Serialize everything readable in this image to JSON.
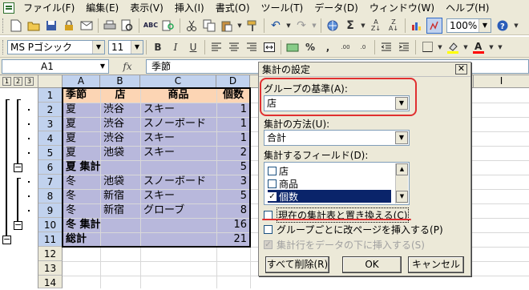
{
  "menu": [
    "ファイル(F)",
    "編集(E)",
    "表示(V)",
    "挿入(I)",
    "書式(O)",
    "ツール(T)",
    "データ(D)",
    "ウィンドウ(W)",
    "ヘルプ(H)"
  ],
  "toolbar": {
    "zoom": "100%"
  },
  "format_bar": {
    "font": "MS Pゴシック",
    "size": "11"
  },
  "formula_bar": {
    "name_box": "A1",
    "fx": "fx",
    "formula": "季節"
  },
  "sheet": {
    "columns": [
      "A",
      "B",
      "C",
      "D"
    ],
    "extra_column": "I",
    "row_numbers": [
      "1",
      "2",
      "3",
      "4",
      "5",
      "6",
      "7",
      "8",
      "9",
      "10",
      "11",
      "12",
      "13",
      "14"
    ],
    "outline_levels": [
      "1",
      "2",
      "3"
    ],
    "headers": [
      "季節",
      "店",
      "商品",
      "個数"
    ],
    "rows": [
      {
        "a": "夏",
        "b": "渋谷",
        "c": "スキー",
        "d": "1"
      },
      {
        "a": "夏",
        "b": "渋谷",
        "c": "スノーボード",
        "d": "1"
      },
      {
        "a": "夏",
        "b": "渋谷",
        "c": "スキー",
        "d": "1"
      },
      {
        "a": "夏",
        "b": "池袋",
        "c": "スキー",
        "d": "2"
      },
      {
        "a": "夏 集計",
        "b": "",
        "c": "",
        "d": "5"
      },
      {
        "a": "冬",
        "b": "池袋",
        "c": "スノーボード",
        "d": "3"
      },
      {
        "a": "冬",
        "b": "新宿",
        "c": "スキー",
        "d": "5"
      },
      {
        "a": "冬",
        "b": "新宿",
        "c": "グローブ",
        "d": "8"
      },
      {
        "a": "冬 集計",
        "b": "",
        "c": "",
        "d": "16"
      },
      {
        "a": "総計",
        "b": "",
        "c": "",
        "d": "21"
      }
    ]
  },
  "dialog": {
    "title": "集計の設定",
    "group_by_label": "グループの基準(A):",
    "group_by_value": "店",
    "function_label": "集計の方法(U):",
    "function_value": "合計",
    "fields_label": "集計するフィールド(D):",
    "fields": [
      {
        "label": "店",
        "checked": false
      },
      {
        "label": "商品",
        "checked": false
      },
      {
        "label": "個数",
        "checked": true
      }
    ],
    "options": [
      {
        "label": "現在の集計表と置き換える(C)",
        "checked": false,
        "enabled": true
      },
      {
        "label": "グループごとに改ページを挿入する(P)",
        "checked": false,
        "enabled": true
      },
      {
        "label": "集計行をデータの下に挿入する(S)",
        "checked": true,
        "enabled": false
      }
    ],
    "remove_all_label": "すべて削除(R)",
    "ok_label": "OK",
    "cancel_label": "キャンセル"
  },
  "colors": {
    "header_fill": "#fcd5b4",
    "selection_fill": "#b8b8dc",
    "annotation": "#e03030"
  }
}
